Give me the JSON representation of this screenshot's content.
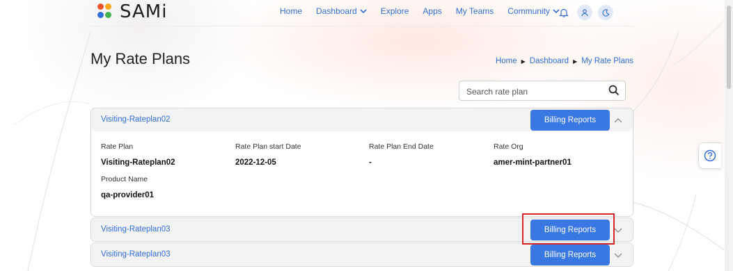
{
  "app": {
    "brand": "SAMi"
  },
  "nav": {
    "items": [
      {
        "label": "Home"
      },
      {
        "label": "Dashboard",
        "chevron": true
      },
      {
        "label": "Explore"
      },
      {
        "label": "Apps"
      },
      {
        "label": "My Teams"
      },
      {
        "label": "Community",
        "chevron": true
      }
    ],
    "icons": [
      "bell-icon",
      "user-icon",
      "moon-icon"
    ]
  },
  "page": {
    "title": "My Rate Plans",
    "breadcrumb": [
      "Home",
      "Dashboard",
      "My Rate Plans"
    ]
  },
  "search": {
    "placeholder": "Search rate plan",
    "value": ""
  },
  "rate_plans": [
    {
      "title": "Visiting-Rateplan02",
      "expanded": true,
      "button_label": "Billing Reports",
      "fields": {
        "rate_plan": {
          "label": "Rate Plan",
          "value": "Visiting-Rateplan02"
        },
        "start_date": {
          "label": "Rate Plan start Date",
          "value": "2022-12-05"
        },
        "end_date": {
          "label": "Rate Plan End Date",
          "value": "-"
        },
        "rate_org": {
          "label": "Rate Org",
          "value": "amer-mint-partner01"
        },
        "product_name": {
          "label": "Product Name",
          "value": "qa-provider01"
        }
      }
    },
    {
      "title": "Visiting-Rateplan03",
      "expanded": false,
      "button_label": "Billing Reports"
    },
    {
      "title": "Visiting-Rateplan03",
      "expanded": false,
      "button_label": "Billing Reports"
    }
  ],
  "colors": {
    "accent": "#2f6fd8",
    "button": "#3978e3",
    "highlight": "#d6262a"
  }
}
